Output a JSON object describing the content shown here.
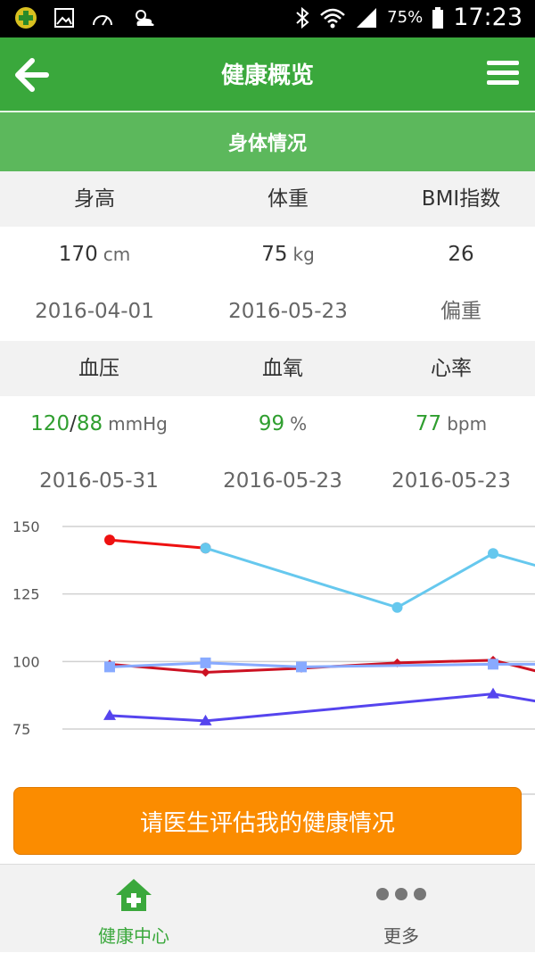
{
  "status_bar": {
    "battery": "75%",
    "time": "17:23"
  },
  "app_bar": {
    "title": "健康概览"
  },
  "section": {
    "title": "身体情况"
  },
  "body_stats": {
    "labels": [
      "身高",
      "体重",
      "BMI指数"
    ],
    "height": {
      "value": "170",
      "unit": "cm",
      "date": "2016-04-01"
    },
    "weight": {
      "value": "75",
      "unit": "kg",
      "date": "2016-05-23"
    },
    "bmi": {
      "value": "26",
      "status": "偏重"
    }
  },
  "vitals": {
    "labels": [
      "血压",
      "血氧",
      "心率"
    ],
    "bp": {
      "systolic": "120",
      "sep": "/",
      "diastolic": "88",
      "unit": "mmHg",
      "date": "2016-05-31"
    },
    "spo2": {
      "value": "99",
      "unit": "%",
      "date": "2016-05-23"
    },
    "hr": {
      "value": "77",
      "unit": "bpm",
      "date": "2016-05-23"
    }
  },
  "chart_data": {
    "type": "line",
    "ylim": [
      60,
      150
    ],
    "y_ticks": [
      150,
      125,
      100,
      75
    ],
    "x": [
      1,
      2,
      3,
      4,
      5,
      5.5
    ],
    "series": [
      {
        "color": "#ee1111",
        "marker": "circle",
        "points": [
          [
            1,
            145
          ],
          [
            2,
            142
          ]
        ]
      },
      {
        "color": "#66c8ee",
        "marker": "circle",
        "points": [
          [
            2,
            142
          ],
          [
            4,
            120
          ],
          [
            5,
            140
          ],
          [
            5.5,
            135
          ]
        ]
      },
      {
        "color": "#cc1122",
        "marker": "diamond",
        "points": [
          [
            1,
            99
          ],
          [
            2,
            96
          ],
          [
            3,
            97.5
          ],
          [
            4,
            99.5
          ],
          [
            5,
            100.5
          ],
          [
            5.5,
            96
          ]
        ]
      },
      {
        "color": "#88aaff",
        "marker": "square",
        "points": [
          [
            1,
            98
          ],
          [
            2,
            99.5
          ],
          [
            3,
            98
          ],
          [
            5,
            99
          ],
          [
            5.5,
            99
          ]
        ]
      },
      {
        "color": "#5544ee",
        "marker": "triangle",
        "points": [
          [
            1,
            80
          ],
          [
            2,
            78
          ],
          [
            5,
            88
          ],
          [
            5.5,
            85
          ]
        ]
      }
    ]
  },
  "cta": {
    "label": "请医生评估我的健康情况"
  },
  "bottom_nav": {
    "health_center": "健康中心",
    "more": "更多"
  },
  "colors": {
    "primary_green": "#3aa83c",
    "section_green": "#5cb85c",
    "accent_orange": "#fb8c00",
    "alert_red": "#e01a1a",
    "ok_green": "#2f9e2f"
  }
}
